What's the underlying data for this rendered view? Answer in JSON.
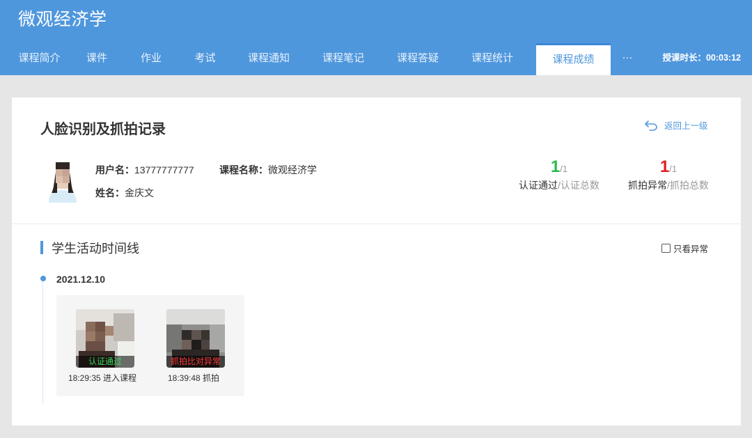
{
  "header": {
    "app_title": "微观经济学",
    "tabs": [
      {
        "label": "课程简介"
      },
      {
        "label": "课件"
      },
      {
        "label": "作业"
      },
      {
        "label": "考试"
      },
      {
        "label": "课程通知"
      },
      {
        "label": "课程笔记"
      },
      {
        "label": "课程答疑"
      },
      {
        "label": "课程统计"
      },
      {
        "label": "课程成绩",
        "active": true
      }
    ],
    "more_label": "···",
    "duration_text": "授课时长：00:03:12"
  },
  "card": {
    "title": "人脸识别及抓拍记录",
    "back_label": "返回上一级",
    "user": {
      "username_label": "用户名：",
      "username": "13777777777",
      "name_label": "姓名：",
      "name": "金庆文",
      "course_label": "课程名称：",
      "course": "微观经济学"
    },
    "stats": [
      {
        "value": "1",
        "total": "/1",
        "label_main": "认证通过",
        "label_sub": "/认证总数",
        "color": "#2db84d"
      },
      {
        "value": "1",
        "total": "/1",
        "label_main": "抓拍异常",
        "label_sub": "/抓拍总数",
        "color": "#e02020"
      }
    ]
  },
  "timeline": {
    "section_title": "学生活动时间线",
    "filter_label": "只看异常",
    "filter_checked": false,
    "date": "2021.12.10",
    "snapshots": [
      {
        "tag": "认证通过",
        "tag_color": "#3ad65a",
        "caption": "18:29:35 进入课程"
      },
      {
        "tag": "抓拍比对异常",
        "tag_color": "#ff3b3b",
        "caption": "18:39:48 抓拍"
      }
    ]
  }
}
